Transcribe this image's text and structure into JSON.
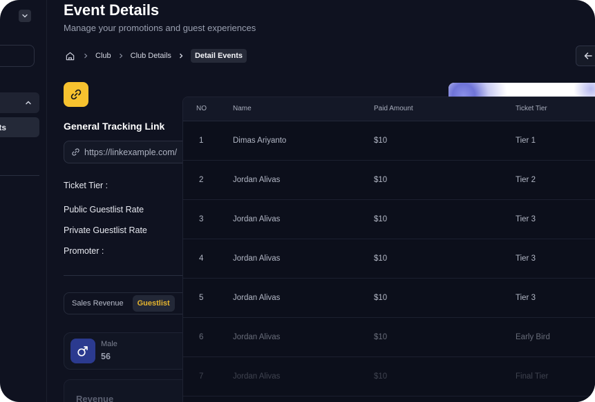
{
  "header": {
    "title": "Event Details",
    "subtitle": "Manage your promotions and guest experiences"
  },
  "breadcrumb": {
    "items": [
      "Club",
      "Club Details"
    ],
    "active": "Detail Events"
  },
  "sidebar": {
    "active_item_partial": "ts"
  },
  "tracking": {
    "title": "General Tracking Link",
    "url": "https://linkexample.com/"
  },
  "info_labels": {
    "ticket_tier": "Ticket Tier :",
    "public_rate": "Public Guestlist Rate",
    "private_rate": "Private Guestlist Rate",
    "promoter": "Promoter :"
  },
  "segment_tabs": [
    "Sales Revenue",
    "Guestlist"
  ],
  "segment_active": "Guestlist",
  "stats": {
    "male_label": "Male",
    "male_value": "56",
    "revenue_label": "Revenue"
  },
  "table": {
    "columns": [
      "NO",
      "Name",
      "Paid Amount",
      "Ticket Tier"
    ],
    "rows": [
      {
        "no": "1",
        "name": "Dimas Ariyanto",
        "paid": "$10",
        "tier": "Tier 1"
      },
      {
        "no": "2",
        "name": "Jordan Alivas",
        "paid": "$10",
        "tier": "Tier 2"
      },
      {
        "no": "3",
        "name": "Jordan Alivas",
        "paid": "$10",
        "tier": "Tier 3"
      },
      {
        "no": "4",
        "name": "Jordan Alivas",
        "paid": "$10",
        "tier": "Tier 3"
      },
      {
        "no": "5",
        "name": "Jordan Alivas",
        "paid": "$10",
        "tier": "Tier 3"
      },
      {
        "no": "6",
        "name": "Jordan Alivas",
        "paid": "$10",
        "tier": "Early Bird"
      },
      {
        "no": "7",
        "name": "Jordan Alivas",
        "paid": "$10",
        "tier": "Final Tier"
      }
    ]
  },
  "icons": {
    "link": "link-icon",
    "home": "home-icon",
    "back": "arrow-left-icon",
    "male": "male-icon"
  },
  "colors": {
    "background": "#0f1220",
    "accent": "#f7c22f",
    "male_icon_bg": "#2b3a8f"
  }
}
